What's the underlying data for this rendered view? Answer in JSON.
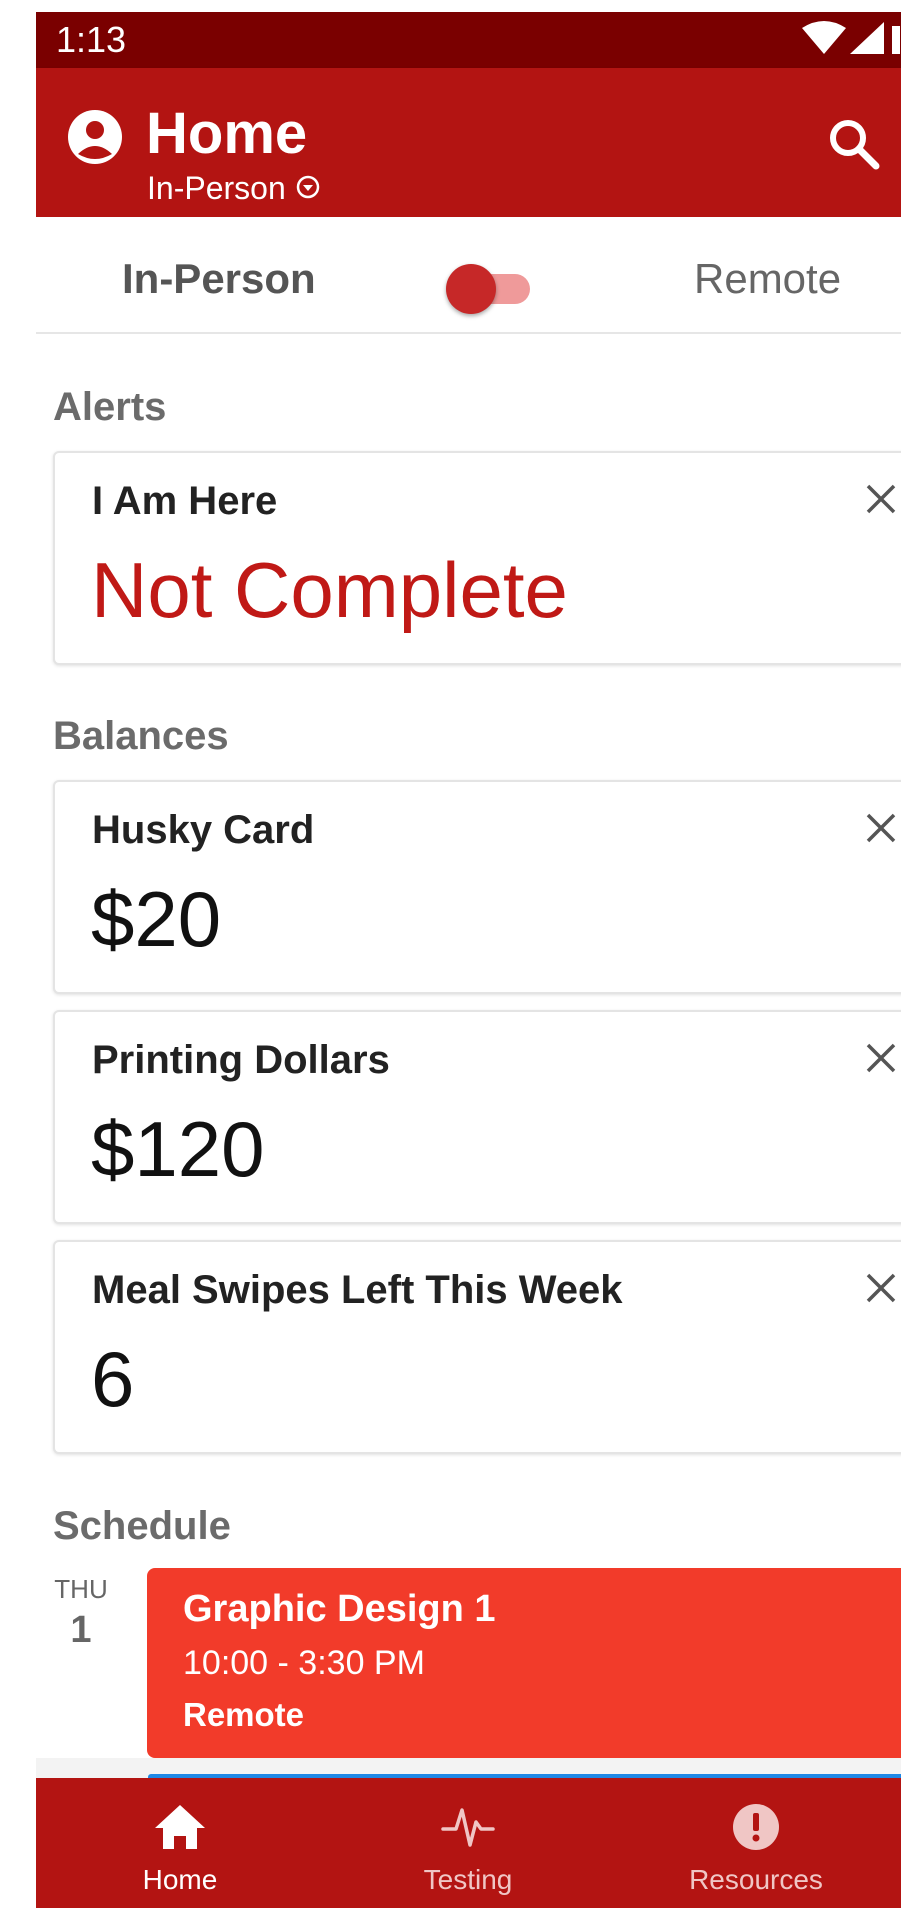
{
  "status_bar": {
    "time": "1:13",
    "icons": [
      "wifi-icon",
      "cell-signal-icon"
    ]
  },
  "app_bar": {
    "title": "Home",
    "mode_label": "In-Person",
    "icons": [
      "account-circle-icon",
      "search-icon",
      "dropdown-circle-icon"
    ]
  },
  "mode_toggle": {
    "left_label": "In-Person",
    "right_label": "Remote",
    "is_remote": false
  },
  "alerts": {
    "section_title": "Alerts",
    "cards": [
      {
        "title": "I Am Here",
        "value": "Not Complete"
      }
    ]
  },
  "balances": {
    "section_title": "Balances",
    "cards": [
      {
        "title": "Husky Card",
        "value": "$20"
      },
      {
        "title": "Printing Dollars",
        "value": "$120"
      },
      {
        "title": "Meal Swipes Left This Week",
        "value": "6"
      }
    ]
  },
  "schedule": {
    "section_title": "Schedule",
    "day": {
      "weekday": "THU",
      "date": "1"
    },
    "events": [
      {
        "title": "Graphic Design 1",
        "time": "10:00 - 3:30 PM",
        "location": "Remote"
      }
    ]
  },
  "bottom_nav": {
    "items": [
      {
        "label": "Home",
        "icon": "home-icon",
        "active": true
      },
      {
        "label": "Testing",
        "icon": "pulse-icon",
        "active": false
      },
      {
        "label": "Resources",
        "icon": "alert-circle-icon",
        "active": false
      }
    ]
  },
  "colors": {
    "primary": "#b31412",
    "status_bar": "#7a0000",
    "alert_text": "#c01916",
    "event_bg": "#f23b2a",
    "accent_blue": "#1e88e5"
  }
}
